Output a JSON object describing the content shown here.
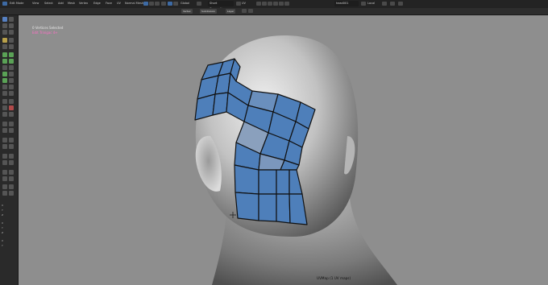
{
  "menubar": {
    "items": [
      "Edit Mode",
      "View",
      "Select",
      "Add",
      "Mesh",
      "Vertex",
      "Edge",
      "Face",
      "UV",
      "Normal Mesh"
    ],
    "transform_orientation": "Global",
    "snap_label": "Short Connection",
    "proportional_label": "UV"
  },
  "toolbar": {
    "select_mode": "Vertex",
    "shading_label": "Subdivision",
    "layer_label": "Layer",
    "object_field": "head001",
    "pivot_label": "Local"
  },
  "viewport": {
    "selection_info": "0 Vertices Selected",
    "mode_label": "Edit Trinigac 4+",
    "uvmap_label": "UVMap (1 UV maps)",
    "background_color": "#8e8e8e",
    "mesh_face_color": "#4e7fba",
    "mesh_edge_color": "#111111"
  },
  "left_panel": {
    "rows": [
      "X",
      "Y",
      "Z",
      "X",
      "Y",
      "Z",
      "X",
      "Y"
    ]
  }
}
